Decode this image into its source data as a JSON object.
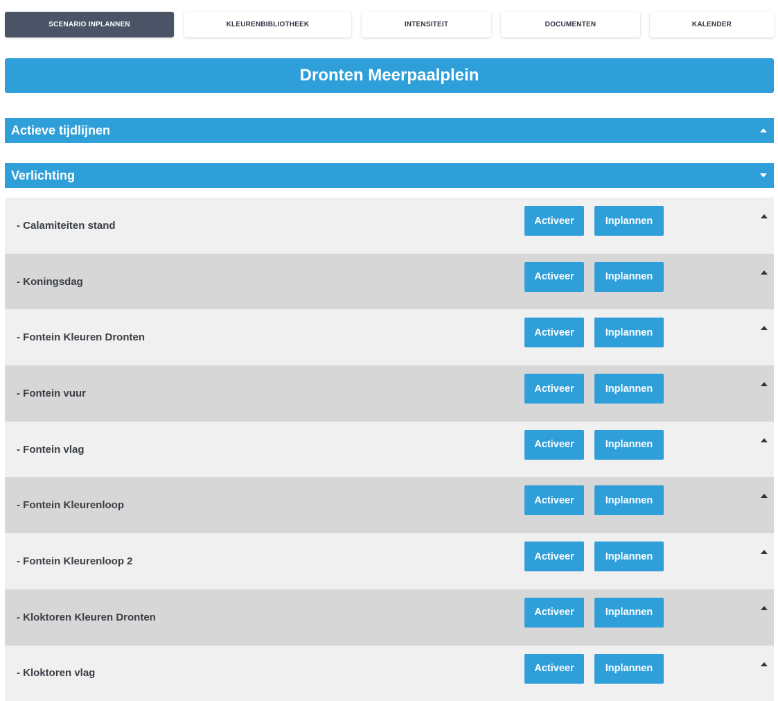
{
  "tabs": [
    {
      "label": "SCENARIO INPLANNEN",
      "active": true
    },
    {
      "label": "KLEURENBIBLIOTHEEK",
      "active": false
    },
    {
      "label": "INTENSITEIT",
      "active": false
    },
    {
      "label": "DOCUMENTEN",
      "active": false
    },
    {
      "label": "KALENDER",
      "active": false
    }
  ],
  "page_title": "Dronten Meerpaalplein",
  "sections": {
    "active_timelines": {
      "label": "Actieve tijdlijnen",
      "caret": "up"
    },
    "lighting": {
      "label": "Verlichting",
      "caret": "down"
    }
  },
  "buttons": {
    "activate_label": "Activeer",
    "schedule_label": "Inplannen"
  },
  "scenarios": [
    {
      "label": "- Calamiteiten stand"
    },
    {
      "label": "- Koningsdag"
    },
    {
      "label": "- Fontein Kleuren Dronten"
    },
    {
      "label": "- Fontein vuur"
    },
    {
      "label": "- Fontein vlag"
    },
    {
      "label": "- Fontein Kleurenloop"
    },
    {
      "label": "- Fontein Kleurenloop 2"
    },
    {
      "label": "- Kloktoren Kleuren Dronten"
    },
    {
      "label": "- Kloktoren vlag"
    }
  ],
  "colors": {
    "accent": "#2f9fd9",
    "active_tab": "#4a5466",
    "row_light": "#f0f0f0",
    "row_dark": "#d7d7d7"
  }
}
